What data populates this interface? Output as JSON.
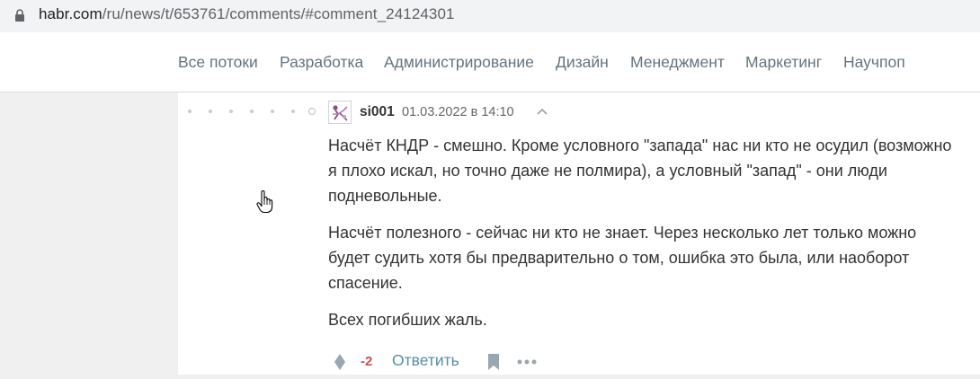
{
  "browser": {
    "url_host": "habr.com",
    "url_path": "/ru/news/t/653761/comments/#comment_24124301"
  },
  "nav": {
    "items": [
      {
        "label": "Все потоки"
      },
      {
        "label": "Разработка"
      },
      {
        "label": "Администрирование"
      },
      {
        "label": "Дизайн"
      },
      {
        "label": "Менеджмент"
      },
      {
        "label": "Маркетинг"
      },
      {
        "label": "Научпоп"
      }
    ]
  },
  "comment": {
    "author": "si001",
    "datetime": "01.03.2022 в 14:10",
    "paragraphs": [
      "Насчёт КНДР - смешно. Кроме условного \"запада\" нас ни кто не осудил (возможно я плохо искал, но точно даже не полмира), а условный \"запад\" - они люди подневольные.",
      "Насчёт полезного - сейчас ни кто не знает. Через несколько лет только можно будет судить хотя бы предварительно о том, ошибка это была, или наоборот спасение.",
      "Всех погибших жаль."
    ],
    "score": "-2",
    "reply_label": "Ответить"
  },
  "colors": {
    "accent_link": "#548eaa",
    "negative_score": "#d04e4e",
    "nav_text": "#65737e"
  },
  "icons": [
    "lock-icon",
    "avatar-icon",
    "chevron-up-icon",
    "vote-icon",
    "bookmark-icon",
    "more-icon",
    "hand-cursor-icon"
  ]
}
